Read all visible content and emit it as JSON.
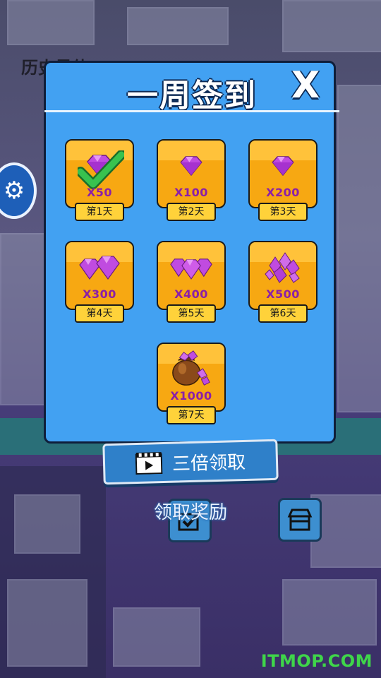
{
  "background": {
    "title_partial": "历史最佳"
  },
  "dialog": {
    "title": "一周签到",
    "close_label": "X",
    "rewards": [
      {
        "amount": "X50",
        "day": "第1天",
        "claimed": true,
        "icon": "gem-single-icon"
      },
      {
        "amount": "X100",
        "day": "第2天",
        "claimed": false,
        "icon": "gem-single-icon"
      },
      {
        "amount": "X200",
        "day": "第3天",
        "claimed": false,
        "icon": "gem-single-icon"
      },
      {
        "amount": "X300",
        "day": "第4天",
        "claimed": false,
        "icon": "gem-pair-icon"
      },
      {
        "amount": "X400",
        "day": "第5天",
        "claimed": false,
        "icon": "gem-triple-icon"
      },
      {
        "amount": "X500",
        "day": "第6天",
        "claimed": false,
        "icon": "gem-pile-icon"
      },
      {
        "amount": "X1000",
        "day": "第7天",
        "claimed": false,
        "icon": "gem-bag-icon"
      }
    ]
  },
  "actions": {
    "triple_claim_label": "三倍领取",
    "claim_label": "领取奖励"
  },
  "watermark": "ITMOP.COM",
  "colors": {
    "dialog_bg": "#42a1f2",
    "card_bg": "#f7a812",
    "gem": "#c04be0",
    "amount_text": "#8b1fa8",
    "check": "#2fb84a"
  }
}
